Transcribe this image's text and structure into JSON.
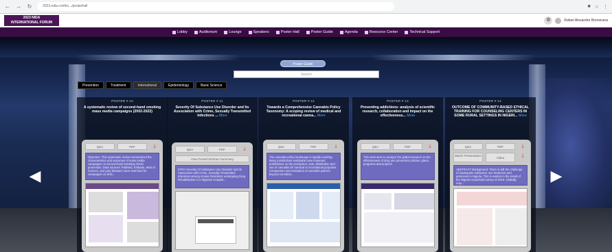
{
  "browser": {
    "url": "2023.ndia.confex.../posterhall"
  },
  "header": {
    "logo_line1": "2023 NIDA",
    "logo_line2": "INTERNATIONAL FORUM",
    "user_name": "Rafael Alexandre Bonnevera"
  },
  "nav": {
    "items": [
      {
        "label": "Lobby",
        "icon": "home-icon"
      },
      {
        "label": "Auditorium",
        "icon": "auditorium-icon"
      },
      {
        "label": "Lounge",
        "icon": "lounge-icon"
      },
      {
        "label": "Speakers",
        "icon": "speakers-icon"
      },
      {
        "label": "Poster Hall",
        "icon": "poster-icon"
      },
      {
        "label": "Poster Guide",
        "icon": "guide-icon"
      },
      {
        "label": "Agenda",
        "icon": "agenda-icon"
      },
      {
        "label": "Resource Center",
        "icon": "resource-icon"
      },
      {
        "label": "Technical Support",
        "icon": "support-icon"
      }
    ]
  },
  "hall": {
    "guide_button": "Poster Guide",
    "search_placeholder": "Search",
    "tabs": [
      "Prevention",
      "Treatment",
      "International",
      "Epidemiology",
      "Basic Science"
    ],
    "active_tab": "International"
  },
  "posters": [
    {
      "num": "POSTER # 10",
      "title": "A systematic review of second-hand smoking mass media campaigns (2002-2022)",
      "more": "",
      "buttons": [
        "Q&A",
        "PDF"
      ],
      "summary": "Objective: This systematic review summarized the characteristics and outcomes of mass media campaigns on second-hand smoking (SHS) prevention. Data sources: PubMed, Embase, Web of Science, and gray literature were searched for campaigns on SHS..."
    },
    {
      "num": "POSTER # 11",
      "title": "Severity Of Substance Use Disorder and Its Association with Crime, Sexually Transmitted Infections ...",
      "more": "More",
      "buttons": [
        "Q&A",
        "PDF"
      ],
      "extra": "View Poster/Abstract Summary",
      "summary": "STRA Severity Of Substance Use Disorder and its Association with Crime, Sexually Transmitted Infections among Inmate Residents undergoing Drug Rehabilitation in a Nigerian Hospital..."
    },
    {
      "num": "POSTER # 12",
      "title": "Towards a Comprehensive Cannabis Policy Taxonomy: A scoping review of medical and recreational canna...",
      "more": "More",
      "buttons": [
        "Q&A",
        "PDF"
      ],
      "summary": "The cannabis policy landscape is rapidly evolving. Many jurisdictions worldwide have loosened prohibitions on the production, sale, distribution and use of cannabis for medical or recreational purposes. Comparison and evaluation of cannabis policies beyond cannabis..."
    },
    {
      "num": "POSTER # 13",
      "title": "Preventing addictions: analysis of scientific research, collaboration and impact on the effectiveness...",
      "more": "More",
      "buttons": [
        "Q&A",
        "PDF"
      ],
      "summary": "This work aims to analyze the global research on the effectiveness of drug use prevention policies, plans, programs and projects."
    },
    {
      "num": "POSTER # 14",
      "title": "OUTCOME OF COMMUNITY-BASED ETHICAL TRAINING FOR COUNSELING CENTERS IN SOME RURAL SETTINGS IN NIGERI...",
      "more": "More",
      "buttons": [
        "Q&A",
        "PDF"
      ],
      "extra2": [
        "Watch Presentation",
        "Video"
      ],
      "summary": "ABSTRACT Background: There is still the challenge of inadequate substance use treatment and personnel in Nigeria. This is evident in the result of the Nigeria Household survey of 2018. Globally, only..."
    }
  ]
}
